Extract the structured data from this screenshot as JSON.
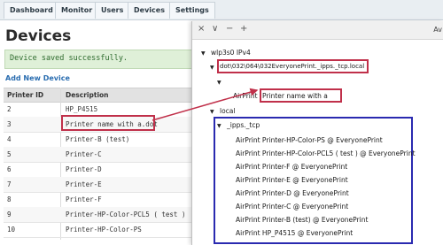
{
  "nav": {
    "tabs": [
      "Dashboard",
      "Monitor",
      "Users",
      "Devices",
      "Settings"
    ]
  },
  "page": {
    "title": "Devices",
    "alert": "Device saved successfully.",
    "add_link": "Add New Device"
  },
  "table": {
    "headers": [
      "Printer ID",
      "Description"
    ],
    "rows": [
      {
        "id": "2",
        "desc": "HP_P4515"
      },
      {
        "id": "3",
        "desc": "Printer name with a.dot"
      },
      {
        "id": "4",
        "desc": "Printer-B (test)"
      },
      {
        "id": "5",
        "desc": "Printer-C"
      },
      {
        "id": "6",
        "desc": "Printer-D"
      },
      {
        "id": "7",
        "desc": "Printer-E"
      },
      {
        "id": "8",
        "desc": "Printer-F"
      },
      {
        "id": "9",
        "desc": "Printer-HP-Color-PCL5 ( test )"
      },
      {
        "id": "10",
        "desc": "Printer-HP-Color-PS"
      }
    ]
  },
  "window": {
    "title": "Av",
    "buttons": [
      "×",
      "∨",
      "−",
      "+"
    ],
    "tree": {
      "interface": "wlp3s0 IPv4",
      "escaped_name": "dot\\032\\064\\032EveryonePrint._ipps._tcp.local",
      "airprint_prefix": "AirPrint",
      "airprint_dot": "Printer name with a",
      "local": "local",
      "ipps": "_ipps._tcp",
      "services": [
        "AirPrint Printer-HP-Color-PS @ EveryonePrint",
        "AirPrint Printer-HP-Color-PCL5 ( test ) @ EveryonePrint",
        "AirPrint Printer-F @ EveryonePrint",
        "AirPrint Printer-E @ EveryonePrint",
        "AirPrint Printer-D @ EveryonePrint",
        "AirPrint Printer-C @ EveryonePrint",
        "AirPrint Printer-B (test) @ EveryonePrint",
        "AirPrint HP_P4515 @ EveryonePrint"
      ]
    }
  },
  "colors": {
    "highlight_red": "#c0304a",
    "highlight_blue": "#2a2ab0",
    "alert_bg": "#dff0d8",
    "link": "#2a6db0"
  }
}
